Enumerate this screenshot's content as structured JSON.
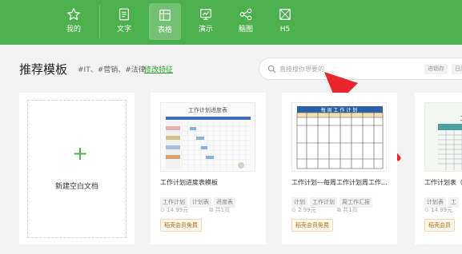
{
  "nav": {
    "items": [
      {
        "label": "我的",
        "icon": "star-icon"
      },
      {
        "label": "文字",
        "icon": "document-icon"
      },
      {
        "label": "表格",
        "icon": "table-icon"
      },
      {
        "label": "演示",
        "icon": "presentation-icon"
      },
      {
        "label": "脑图",
        "icon": "mindmap-icon"
      },
      {
        "label": "H5",
        "icon": "h5-icon"
      }
    ],
    "active": "表格",
    "colors": {
      "bar": "#4cb04c",
      "accent": "#4cb04c"
    }
  },
  "header": {
    "title": "推荐模板",
    "tags": "#IT、#营销、#法律",
    "edit_link": "修改特征"
  },
  "search": {
    "placeholder": "直接搜你想要的",
    "chips": [
      "进销存",
      "日历"
    ]
  },
  "new_card": {
    "label": "新建空白文档"
  },
  "templates": [
    {
      "name": "工作计划进度表模板",
      "tags": [
        "工作计划",
        "计划表",
        "进度表"
      ],
      "price": "14.99元",
      "pages": "共1页",
      "badge": "稻壳会员免费",
      "thumb_title": "工作计划进度表"
    },
    {
      "name": "工作计划—每周工作计划周工作...",
      "tags": [
        "计划",
        "工作计划",
        "周工作汇报"
      ],
      "price": "2.99元",
      "pages": "共1页",
      "badge": "稻壳会员免费",
      "thumb_title": "每 周 工 作 计 划"
    },
    {
      "name": "工作计划表（",
      "tags": [
        "计划表",
        "工"
      ],
      "price": "14.99元",
      "pages": "",
      "badge": "稻壳会员",
      "thumb_title": "工 作"
    }
  ]
}
